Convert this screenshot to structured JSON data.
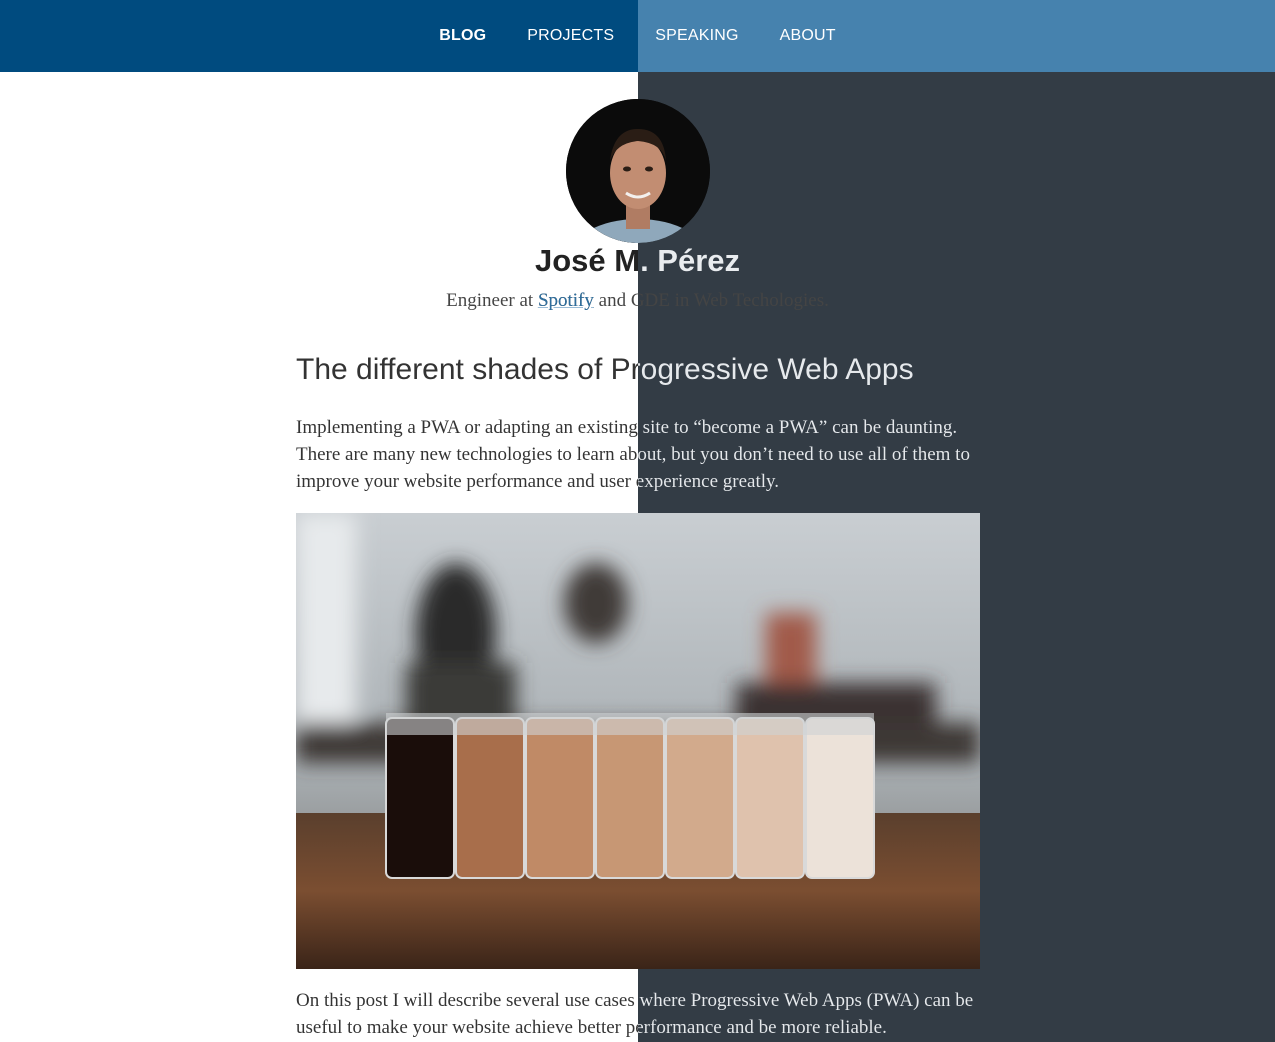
{
  "nav": {
    "items": [
      {
        "label": "BLOG",
        "active": true
      },
      {
        "label": "PROJECTS",
        "active": false
      },
      {
        "label": "SPEAKING",
        "active": false
      },
      {
        "label": "ABOUT",
        "active": false
      }
    ]
  },
  "profile": {
    "name": "José M. Pérez",
    "tagline_prefix": "Engineer at ",
    "tagline_link": "Spotify",
    "tagline_mid": " and ",
    "tagline_abbr": "GDE",
    "tagline_suffix": " in Web Techologies."
  },
  "post": {
    "title": "The different shades of Progressive Web Apps",
    "intro": "Implementing a PWA or adapting an existing site to “become a PWA” can be daunting. There are many new technologies to learn about, but you don’t need to use all of them to improve your website performance and user experience greatly.",
    "body": "On this post I will describe several use cases where Progressive Web Apps (PWA) can be useful to make your website achieve better performance and be more reliable."
  },
  "colors": {
    "nav_left": "#004b7f",
    "nav_right": "#4682ae",
    "bg_right": "#333c45",
    "link": "#2e6e9e"
  }
}
